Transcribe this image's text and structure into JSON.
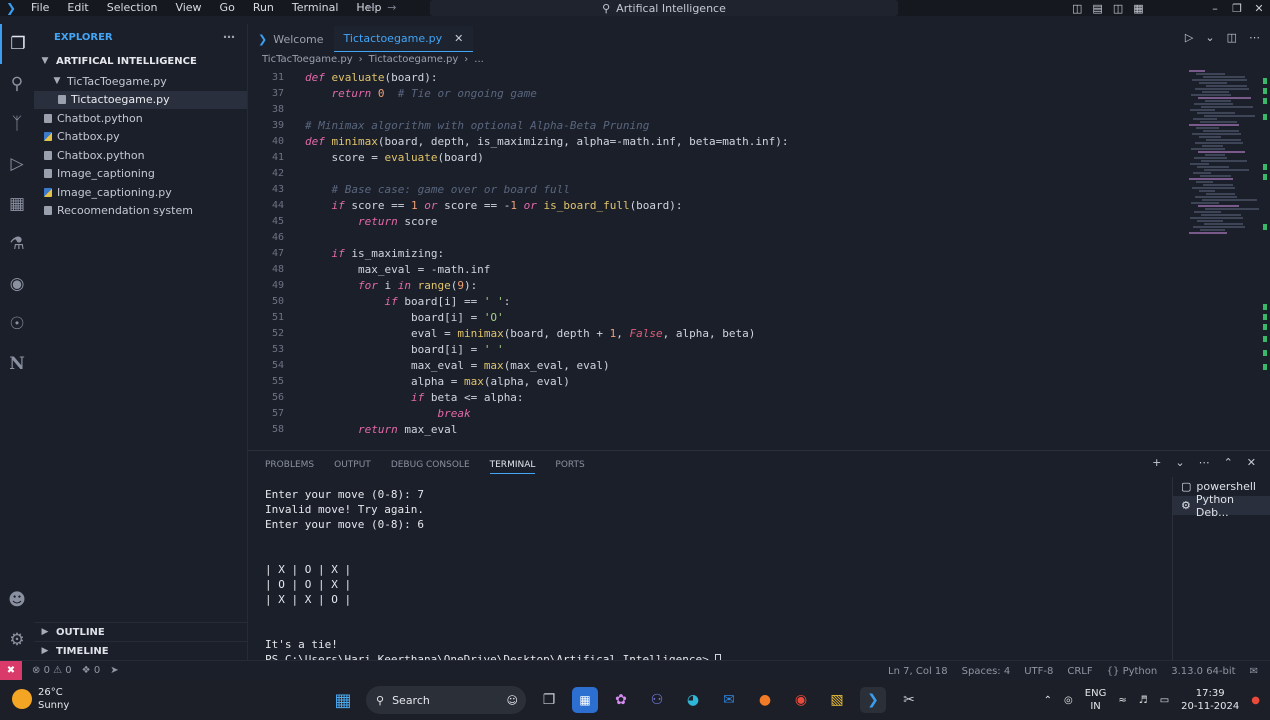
{
  "window": {
    "title": "Artifical Intelligence",
    "menu": [
      "File",
      "Edit",
      "Selection",
      "View",
      "Go",
      "Run",
      "Terminal",
      "Help"
    ]
  },
  "explorer": {
    "header": "EXPLORER",
    "root": "ARTIFICAL INTELLIGENCE",
    "items": [
      {
        "label": "TicTacToegame.py",
        "type": "folder"
      },
      {
        "label": "Tictactoegame.py",
        "type": "py"
      },
      {
        "label": "Chatbot.python",
        "type": "txt"
      },
      {
        "label": "Chatbox.py",
        "type": "py"
      },
      {
        "label": "Chatbox.python",
        "type": "txt"
      },
      {
        "label": "Image_captioning",
        "type": "txt"
      },
      {
        "label": "Image_captioning.py",
        "type": "py"
      },
      {
        "label": "Recoomendation system",
        "type": "txt"
      }
    ],
    "outline": "OUTLINE",
    "timeline": "TIMELINE"
  },
  "tabs": [
    {
      "label": "Welcome"
    },
    {
      "label": "Tictactoegame.py"
    }
  ],
  "breadcrumb": [
    "TicTacToegame.py",
    "Tictactoegame.py",
    "..."
  ],
  "code": {
    "lines": [
      {
        "n": "31",
        "text": "def evaluate(board):"
      },
      {
        "n": "37",
        "text": "    return 0  # Tie or ongoing game"
      },
      {
        "n": "38",
        "text": ""
      },
      {
        "n": "39",
        "text": "# Minimax algorithm with optional Alpha-Beta Pruning"
      },
      {
        "n": "40",
        "text": "def minimax(board, depth, is_maximizing, alpha=-math.inf, beta=math.inf):"
      },
      {
        "n": "41",
        "text": "    score = evaluate(board)"
      },
      {
        "n": "42",
        "text": ""
      },
      {
        "n": "43",
        "text": "    # Base case: game over or board full"
      },
      {
        "n": "44",
        "text": "    if score == 1 or score == -1 or is_board_full(board):"
      },
      {
        "n": "45",
        "text": "        return score"
      },
      {
        "n": "46",
        "text": ""
      },
      {
        "n": "47",
        "text": "    if is_maximizing:"
      },
      {
        "n": "48",
        "text": "        max_eval = -math.inf"
      },
      {
        "n": "49",
        "text": "        for i in range(9):"
      },
      {
        "n": "50",
        "text": "            if board[i] == ' ':"
      },
      {
        "n": "51",
        "text": "                board[i] = 'O'"
      },
      {
        "n": "52",
        "text": "                eval = minimax(board, depth + 1, False, alpha, beta)"
      },
      {
        "n": "53",
        "text": "                board[i] = ' '"
      },
      {
        "n": "54",
        "text": "                max_eval = max(max_eval, eval)"
      },
      {
        "n": "55",
        "text": "                alpha = max(alpha, eval)"
      },
      {
        "n": "56",
        "text": "                if beta <= alpha:"
      },
      {
        "n": "57",
        "text": "                    break"
      },
      {
        "n": "58",
        "text": "        return max_eval"
      }
    ]
  },
  "panel": {
    "tabs": [
      "PROBLEMS",
      "OUTPUT",
      "DEBUG CONSOLE",
      "TERMINAL",
      "PORTS"
    ],
    "active_tab": "TERMINAL",
    "terminal_lines": [
      "Enter your move (0-8): 7",
      "Invalid move! Try again.",
      "Enter your move (0-8): 6",
      "",
      "",
      "| X | O | X |",
      "| O | O | X |",
      "| X | X | O |",
      "",
      "",
      "It's a tie!",
      "PS C:\\Users\\Hari Keerthana\\OneDrive\\Desktop\\Artifical Intelligence> "
    ],
    "terminals": [
      "powershell",
      "Python Deb..."
    ]
  },
  "statusbar": {
    "errors": "0",
    "warnings": "0",
    "ports": "0",
    "position": "Ln 7, Col 18",
    "spaces": "Spaces: 4",
    "encoding": "UTF-8",
    "eol": "CRLF",
    "language": "Python",
    "interpreter": "3.13.0 64-bit"
  },
  "taskbar": {
    "temperature": "26°C",
    "weather": "Sunny",
    "search": "Search",
    "lang": "ENG",
    "region": "IN",
    "time": "17:39",
    "date": "20-11-2024"
  },
  "colors": {
    "accent": "#42a5f5",
    "keyword": "#e36aa9",
    "function": "#e0c46c",
    "comment": "#59667e",
    "remote": "#d93a6a"
  }
}
